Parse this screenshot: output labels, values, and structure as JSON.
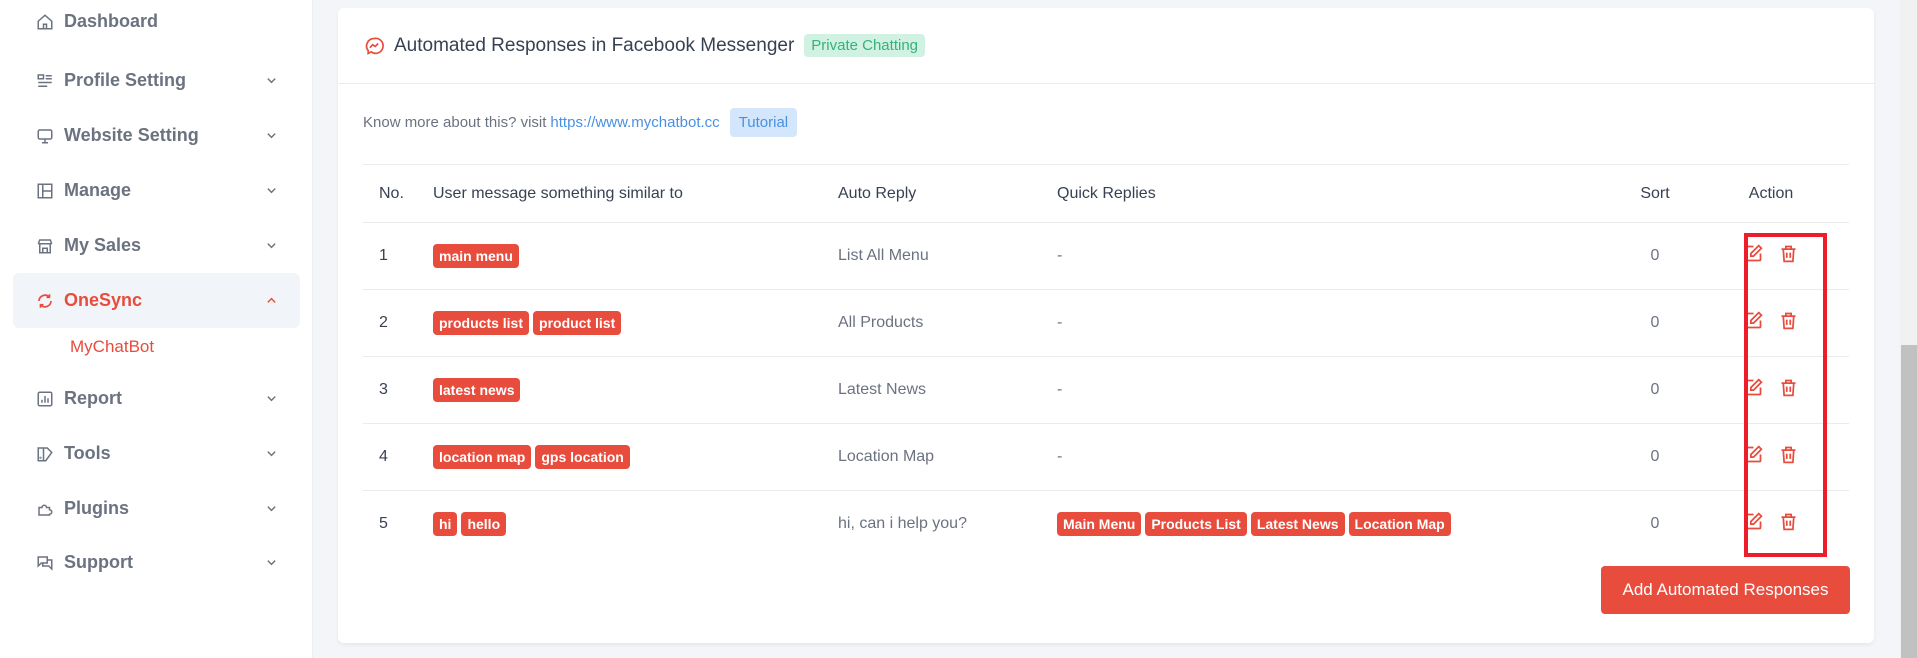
{
  "sidebar": {
    "items": [
      {
        "label": "Dashboard",
        "icon": "home-icon",
        "has_chevron": false
      },
      {
        "label": "Profile Setting",
        "icon": "profile-list-icon",
        "has_chevron": true
      },
      {
        "label": "Website Setting",
        "icon": "monitor-icon",
        "has_chevron": true
      },
      {
        "label": "Manage",
        "icon": "layout-icon",
        "has_chevron": true
      },
      {
        "label": "My Sales",
        "icon": "store-icon",
        "has_chevron": true
      },
      {
        "label": "OneSync",
        "icon": "sync-icon",
        "has_chevron": true,
        "active": true,
        "expanded": true
      },
      {
        "label": "Report",
        "icon": "chart-icon",
        "has_chevron": true
      },
      {
        "label": "Tools",
        "icon": "tools-icon",
        "has_chevron": true
      },
      {
        "label": "Plugins",
        "icon": "puzzle-icon",
        "has_chevron": true
      },
      {
        "label": "Support",
        "icon": "chat-support-icon",
        "has_chevron": true
      }
    ],
    "sub_items": [
      {
        "label": "MyChatBot",
        "active": true
      }
    ]
  },
  "card": {
    "title": "Automated Responses in Facebook Messenger",
    "badge": "Private Chatting",
    "info_text": "Know more about this? visit",
    "info_link": "https://www.mychatbot.cc",
    "tutorial_label": "Tutorial"
  },
  "table": {
    "headers": [
      "No.",
      "User message something similar to",
      "Auto Reply",
      "Quick Replies",
      "Sort",
      "Action"
    ],
    "rows": [
      {
        "no": "1",
        "keywords": [
          "main menu"
        ],
        "reply": "List All Menu",
        "quick": "-",
        "quick_tags": [],
        "sort": "0"
      },
      {
        "no": "2",
        "keywords": [
          "products list",
          "product list"
        ],
        "reply": "All Products",
        "quick": "-",
        "quick_tags": [],
        "sort": "0"
      },
      {
        "no": "3",
        "keywords": [
          "latest news"
        ],
        "reply": "Latest News",
        "quick": "-",
        "quick_tags": [],
        "sort": "0"
      },
      {
        "no": "4",
        "keywords": [
          "location map",
          "gps location"
        ],
        "reply": "Location Map",
        "quick": "-",
        "quick_tags": [],
        "sort": "0"
      },
      {
        "no": "5",
        "keywords": [
          "hi",
          "hello"
        ],
        "reply": "hi, can i help you?",
        "quick": "",
        "quick_tags": [
          "Main Menu",
          "Products List",
          "Latest News",
          "Location Map"
        ],
        "sort": "0"
      }
    ],
    "actions": {
      "edit": "edit-icon",
      "delete": "trash-icon"
    }
  },
  "add_button_label": "Add Automated Responses",
  "colors": {
    "accent": "#e74c3c",
    "success_badge_bg": "#d1f2e3",
    "success_badge_text": "#34b27b",
    "info_badge_bg": "#d4e6fb",
    "link": "#4a90e2",
    "highlight_box": "#ee1d2a"
  }
}
